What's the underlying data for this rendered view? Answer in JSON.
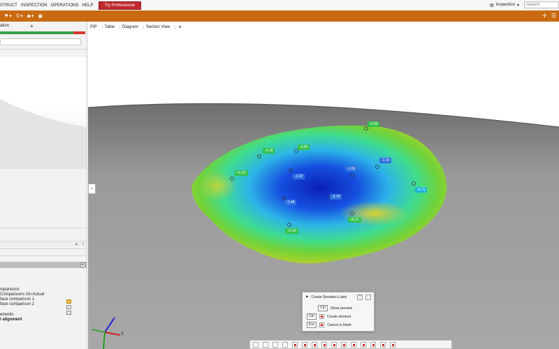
{
  "menubar": {
    "items": [
      "STRUCT",
      "INSPECTION",
      "OPERATIONS",
      "HELP"
    ],
    "try_pro": "Try Professional",
    "workspace": "Inspection",
    "search_placeholder": "Search"
  },
  "left_panel": {
    "tab_label": "ation",
    "plus": "+",
    "tree": {
      "line1": "mparisons",
      "line2": "Comparisons On Actual",
      "line3": "face comparison 1",
      "line4": "face comparison 2",
      "line5": "ements",
      "line6": "l alignment"
    }
  },
  "view_tabs": [
    "PIP",
    "Table",
    "Diagram",
    "Section View"
  ],
  "view_tab_plus": "+",
  "deviation_labels": [
    {
      "text": "-0.09",
      "color": "green"
    },
    {
      "text": "-3.18",
      "color": "green"
    },
    {
      "text": "-0.40",
      "color": "green"
    },
    {
      "text": "+0.33",
      "color": "green"
    },
    {
      "text": "-2.47",
      "color": "blue"
    },
    {
      "text": "-1.63",
      "color": "blue"
    },
    {
      "text": "-1.02",
      "color": "blue"
    },
    {
      "text": "-1.48",
      "color": "blue"
    },
    {
      "text": "-3.74",
      "color": "blue"
    },
    {
      "text": "-0.71",
      "color": "cyan"
    },
    {
      "text": "+0.21",
      "color": "green"
    },
    {
      "text": "+1.00",
      "color": "green"
    }
  ],
  "popup": {
    "title": "Create Deviation Label",
    "help": "?",
    "more": "...",
    "rows": [
      {
        "key": "Ctrl",
        "action": "Show preview"
      },
      {
        "key": "Ctrl",
        "action": "Create element"
      },
      {
        "key": "Esc",
        "action": "Cancel or finish"
      }
    ]
  },
  "axis": {
    "x": "X",
    "y": "Y",
    "z": "Z"
  },
  "colors": {
    "toolbar": "#c96a10",
    "try_pro": "#c0282d",
    "progress_good": "#3aa04a",
    "progress_bad": "#d9382d"
  }
}
